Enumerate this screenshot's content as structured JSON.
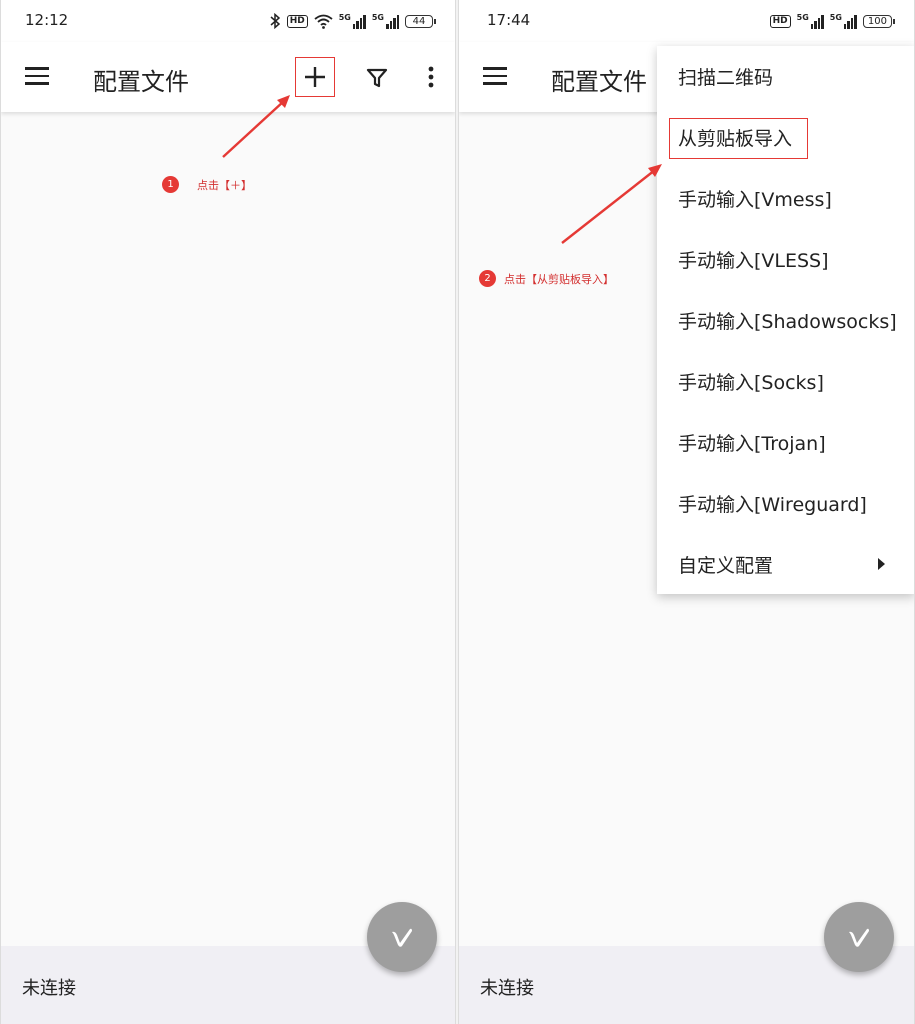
{
  "left": {
    "status_time": "12:12",
    "battery": "44",
    "title": "配置文件",
    "annotation_step": "1",
    "annotation_text": "点击【＋】",
    "connection_status": "未连接"
  },
  "right": {
    "status_time": "17:44",
    "battery": "100",
    "title": "配置文件",
    "annotation_step": "2",
    "annotation_text": "点击【从剪贴板导入】",
    "connection_status": "未连接",
    "menu_items": [
      "扫描二维码",
      "从剪贴板导入",
      "手动输入[Vmess]",
      "手动输入[VLESS]",
      "手动输入[Shadowsocks]",
      "手动输入[Socks]",
      "手动输入[Trojan]",
      "手动输入[Wireguard]",
      "自定义配置"
    ]
  },
  "status_icons": {
    "hd_label": "HD",
    "network_label": "5G"
  },
  "icons": [
    "bluetooth-icon",
    "wifi-icon",
    "menu-icon",
    "add-icon",
    "filter-icon",
    "more-vert-icon",
    "v2ray-icon",
    "chevron-right-icon"
  ],
  "colors": {
    "annotation_red": "#e53935",
    "fab_gray": "#9e9e9e",
    "bottom_bar": "#f0eff4"
  }
}
